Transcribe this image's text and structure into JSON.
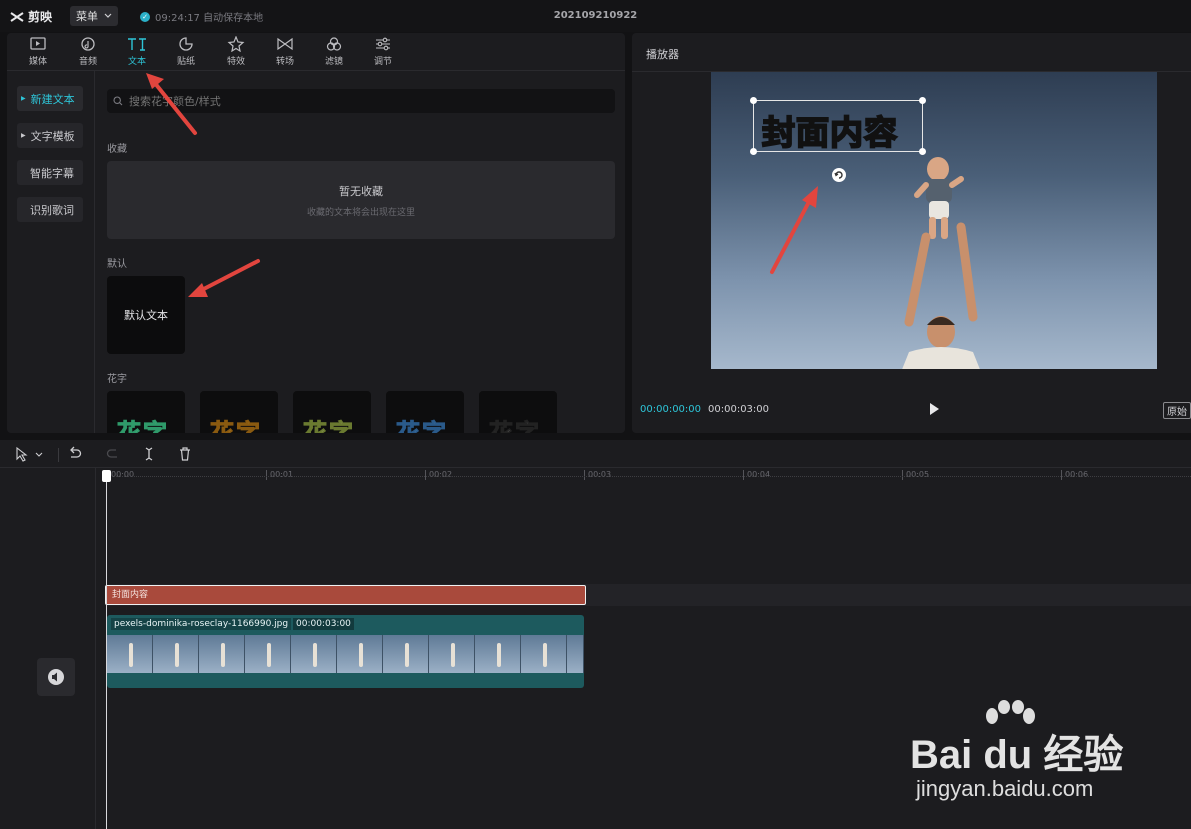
{
  "app": {
    "logo_text": "剪映",
    "menu_label": "菜单",
    "save_status": "09:24:17 自动保存本地",
    "project_name": "202109210922"
  },
  "toolbar": {
    "tabs": [
      {
        "label": "媒体",
        "icon": "media-icon"
      },
      {
        "label": "音频",
        "icon": "audio-icon"
      },
      {
        "label": "文本",
        "icon": "text-icon",
        "active": true
      },
      {
        "label": "贴纸",
        "icon": "sticker-icon"
      },
      {
        "label": "特效",
        "icon": "effects-icon"
      },
      {
        "label": "转场",
        "icon": "transition-icon"
      },
      {
        "label": "滤镜",
        "icon": "filter-icon"
      },
      {
        "label": "调节",
        "icon": "adjust-icon"
      }
    ]
  },
  "sidebar": {
    "items": [
      {
        "label": "新建文本",
        "active": true
      },
      {
        "label": "文字模板"
      },
      {
        "label": "智能字幕"
      },
      {
        "label": "识别歌词"
      }
    ]
  },
  "search": {
    "placeholder": "搜索花字颜色/样式"
  },
  "favorites": {
    "section_label": "收藏",
    "empty_title": "暂无收藏",
    "empty_subtitle": "收藏的文本将会出现在这里"
  },
  "default_section": {
    "section_label": "默认",
    "card_label": "默认文本"
  },
  "fancy_section": {
    "section_label": "花字",
    "preview_text": "花字",
    "colors": [
      "#b8f0c0",
      "#f6d36a",
      "#f2f2f2",
      "#8fc6ec",
      "#ffffff"
    ]
  },
  "player": {
    "title": "播放器",
    "cover_text": "封面内容",
    "time_current": "00:00:00:00",
    "time_total": "00:00:03:00",
    "ratio_label": "原始"
  },
  "timeline": {
    "ticks": [
      "00:00",
      "00:01",
      "00:02",
      "00:03",
      "00:04",
      "00:05",
      "00:06"
    ],
    "text_clip_label": "封面内容",
    "video_clip_name": "pexels-dominika-roseclay-1166990.jpg",
    "video_clip_duration": "00:00:03:00"
  },
  "watermark": {
    "main": "Bai du 经验",
    "url": "jingyan.baidu.com"
  },
  "colors": {
    "accent": "#2ec5d8",
    "text_clip": "#a94a3c",
    "video_clip": "#1d5a5e",
    "annotation_arrow": "#e2453e"
  }
}
